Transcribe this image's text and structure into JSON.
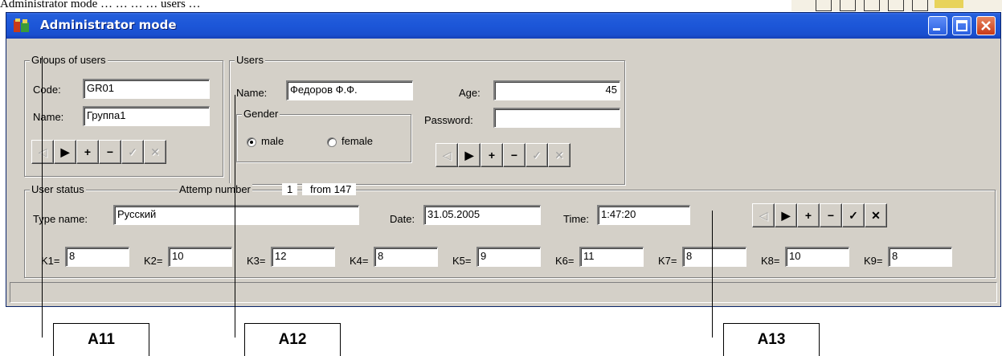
{
  "top_text": "Administrator mode … … … … users …",
  "window": {
    "title": "Administrator mode",
    "title_bar_color": "#245edb",
    "controls": {
      "minimize": "minimize-icon",
      "maximize": "maximize-icon",
      "close": "close-icon"
    }
  },
  "groups_panel": {
    "legend": "Groups of users",
    "code_label": "Code:",
    "code_value": "GR01",
    "name_label": "Name:",
    "name_value": "Группа1",
    "nav": [
      "◁",
      "▶",
      "+",
      "−",
      "✓",
      "✕"
    ]
  },
  "users_panel": {
    "legend": "Users",
    "name_label": "Name:",
    "name_value": "Федоров Ф.Ф.",
    "age_label": "Age:",
    "age_value": "45",
    "password_label": "Password:",
    "password_value": "",
    "gender": {
      "legend": "Gender",
      "options": [
        "male",
        "female"
      ],
      "selected": "male"
    },
    "nav": [
      "◁",
      "▶",
      "+",
      "−",
      "✓",
      "✕"
    ]
  },
  "status_panel": {
    "legend": "User status",
    "attempt_label": "Attemp number",
    "attempt_value": "1",
    "from_label": "from 147",
    "type_label": "Type name:",
    "type_value": "Русский",
    "date_label": "Date:",
    "date_value": "31.05.2005",
    "time_label": "Time:",
    "time_value": "1:47:20",
    "k": [
      {
        "label": "K1=",
        "value": "8"
      },
      {
        "label": "K2=",
        "value": "10"
      },
      {
        "label": "K3=",
        "value": "12"
      },
      {
        "label": "K4=",
        "value": "8"
      },
      {
        "label": "K5=",
        "value": "9"
      },
      {
        "label": "K6=",
        "value": "11"
      },
      {
        "label": "K7=",
        "value": "8"
      },
      {
        "label": "K8=",
        "value": "10"
      },
      {
        "label": "K9=",
        "value": "8"
      }
    ],
    "nav": [
      "◁",
      "▶",
      "+",
      "−",
      "✓",
      "✕"
    ]
  },
  "callouts": [
    "A11",
    "A12",
    "A13"
  ]
}
